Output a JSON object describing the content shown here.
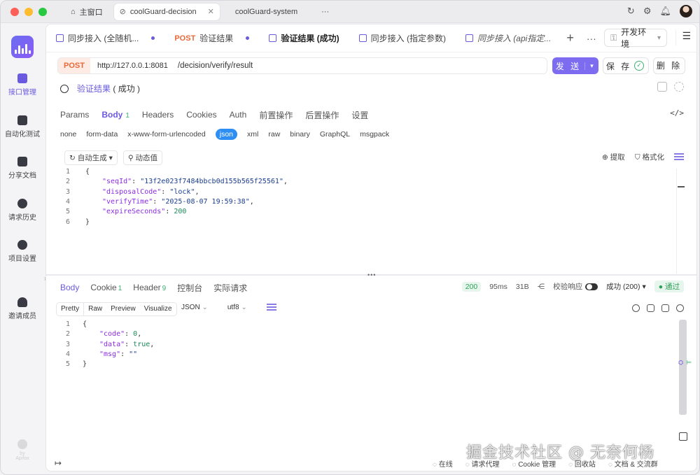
{
  "window": {
    "tabs": [
      {
        "label": "主窗口",
        "active": false
      },
      {
        "label": "coolGuard-decision",
        "active": true
      },
      {
        "label": "coolGuard-system",
        "active": false
      }
    ],
    "more": "···"
  },
  "sidebar": {
    "items": [
      {
        "label": "接口管理",
        "icon": "api-icon",
        "active": true
      },
      {
        "label": "自动化测试",
        "icon": "automation-icon",
        "active": false
      },
      {
        "label": "分享文档",
        "icon": "book-icon",
        "active": false
      },
      {
        "label": "请求历史",
        "icon": "clock-icon",
        "active": false
      },
      {
        "label": "项目设置",
        "icon": "settings-icon",
        "active": false
      },
      {
        "label": "邀请成员",
        "icon": "add-user-icon",
        "active": false
      }
    ],
    "expand": "›",
    "brand_fade": "by Apifox"
  },
  "request_tabs": [
    {
      "method": "",
      "label": "同步接入 (全随机...",
      "dirty": true,
      "active": false
    },
    {
      "method": "POST",
      "label": "验证结果",
      "dirty": true,
      "active": false
    },
    {
      "method": "",
      "label": "验证结果 (成功)",
      "dirty": false,
      "active": true
    },
    {
      "method": "",
      "label": "同步接入 (指定参数)",
      "dirty": false,
      "active": false
    },
    {
      "method": "",
      "label": "同步接入 (api指定...",
      "dirty": false,
      "active": false
    }
  ],
  "tab_actions": {
    "add": "+",
    "more": "···"
  },
  "environment": {
    "label": "开发环境"
  },
  "url": {
    "method": "POST",
    "host": "http://127.0.0.1:8081",
    "path": "/decision/verify/result"
  },
  "actions": {
    "send": "发 送",
    "save": "保 存",
    "delete": "删 除"
  },
  "request_name": {
    "name": "验证结果",
    "suffix": "( 成功 )"
  },
  "sub_tabs": [
    {
      "label": "Params",
      "active": false,
      "badge": ""
    },
    {
      "label": "Body",
      "active": true,
      "badge": "1"
    },
    {
      "label": "Headers",
      "active": false,
      "badge": ""
    },
    {
      "label": "Cookies",
      "active": false,
      "badge": ""
    },
    {
      "label": "Auth",
      "active": false,
      "badge": ""
    },
    {
      "label": "前置操作",
      "active": false,
      "badge": ""
    },
    {
      "label": "后置操作",
      "active": false,
      "badge": ""
    },
    {
      "label": "设置",
      "active": false,
      "badge": ""
    }
  ],
  "body_types": [
    "none",
    "form-data",
    "x-www-form-urlencoded",
    "json",
    "xml",
    "raw",
    "binary",
    "GraphQL",
    "msgpack"
  ],
  "body_type_active": "json",
  "editor_tools": {
    "auto_gen": "自动生成",
    "dynamic": "动态值",
    "extract": "提取",
    "format": "格式化"
  },
  "request_body_lines": [
    {
      "n": "1",
      "indent": 0,
      "parts": [
        {
          "c": "p",
          "t": "{"
        }
      ]
    },
    {
      "n": "2",
      "indent": 1,
      "parts": [
        {
          "c": "k",
          "t": "\"seqId\""
        },
        {
          "c": "p",
          "t": ": "
        },
        {
          "c": "s",
          "t": "\"13f2e023f7484bbcb0d155b565f25561\""
        },
        {
          "c": "p",
          "t": ","
        }
      ]
    },
    {
      "n": "3",
      "indent": 1,
      "parts": [
        {
          "c": "k",
          "t": "\"disposalCode\""
        },
        {
          "c": "p",
          "t": ": "
        },
        {
          "c": "s",
          "t": "\"lock\""
        },
        {
          "c": "p",
          "t": ","
        }
      ]
    },
    {
      "n": "4",
      "indent": 1,
      "parts": [
        {
          "c": "k",
          "t": "\"verifyTime\""
        },
        {
          "c": "p",
          "t": ": "
        },
        {
          "c": "s",
          "t": "\"2025-08-07 19:59:38\""
        },
        {
          "c": "p",
          "t": ","
        }
      ]
    },
    {
      "n": "5",
      "indent": 1,
      "parts": [
        {
          "c": "k",
          "t": "\"expireSeconds\""
        },
        {
          "c": "p",
          "t": ": "
        },
        {
          "c": "n",
          "t": "200"
        }
      ]
    },
    {
      "n": "6",
      "indent": 0,
      "parts": [
        {
          "c": "p",
          "t": "}"
        }
      ]
    }
  ],
  "response_tabs": [
    {
      "label": "Body",
      "badge": "",
      "active": true
    },
    {
      "label": "Cookie",
      "badge": "1",
      "active": false
    },
    {
      "label": "Header",
      "badge": "9",
      "active": false
    },
    {
      "label": "控制台",
      "badge": "",
      "active": false
    },
    {
      "label": "实际请求",
      "badge": "",
      "active": false
    }
  ],
  "response_info": {
    "status": "200",
    "time": "95ms",
    "size": "31B",
    "validate_label": "校验响应",
    "expected": "成功 (200)",
    "result": "通过"
  },
  "response_views": [
    "Pretty",
    "Raw",
    "Preview",
    "Visualize"
  ],
  "response_view_active": "Pretty",
  "response_format": "JSON",
  "response_encoding": "utf8",
  "response_body_lines": [
    {
      "n": "1",
      "indent": 0,
      "parts": [
        {
          "c": "p",
          "t": "{"
        }
      ]
    },
    {
      "n": "2",
      "indent": 1,
      "parts": [
        {
          "c": "k",
          "t": "\"code\""
        },
        {
          "c": "p",
          "t": ": "
        },
        {
          "c": "n",
          "t": "0"
        },
        {
          "c": "p",
          "t": ","
        }
      ]
    },
    {
      "n": "3",
      "indent": 1,
      "parts": [
        {
          "c": "k",
          "t": "\"data\""
        },
        {
          "c": "p",
          "t": ": "
        },
        {
          "c": "n",
          "t": "true"
        },
        {
          "c": "p",
          "t": ","
        }
      ]
    },
    {
      "n": "4",
      "indent": 1,
      "parts": [
        {
          "c": "k",
          "t": "\"msg\""
        },
        {
          "c": "p",
          "t": ": "
        },
        {
          "c": "s",
          "t": "\"\""
        }
      ]
    },
    {
      "n": "5",
      "indent": 0,
      "parts": [
        {
          "c": "p",
          "t": "}"
        }
      ]
    }
  ],
  "bottom_bar": {
    "collapse": "↦",
    "items": [
      "在线",
      "请求代理",
      "Cookie 管理",
      "回收站",
      "文档 & 交流群"
    ]
  },
  "watermark": "掘金技术社区 @ 无奈何杨",
  "colors": {
    "accent": "#6a5ae0",
    "post": "#e8693a",
    "success": "#2f9e5a",
    "json_pill": "#2f8ef4"
  }
}
